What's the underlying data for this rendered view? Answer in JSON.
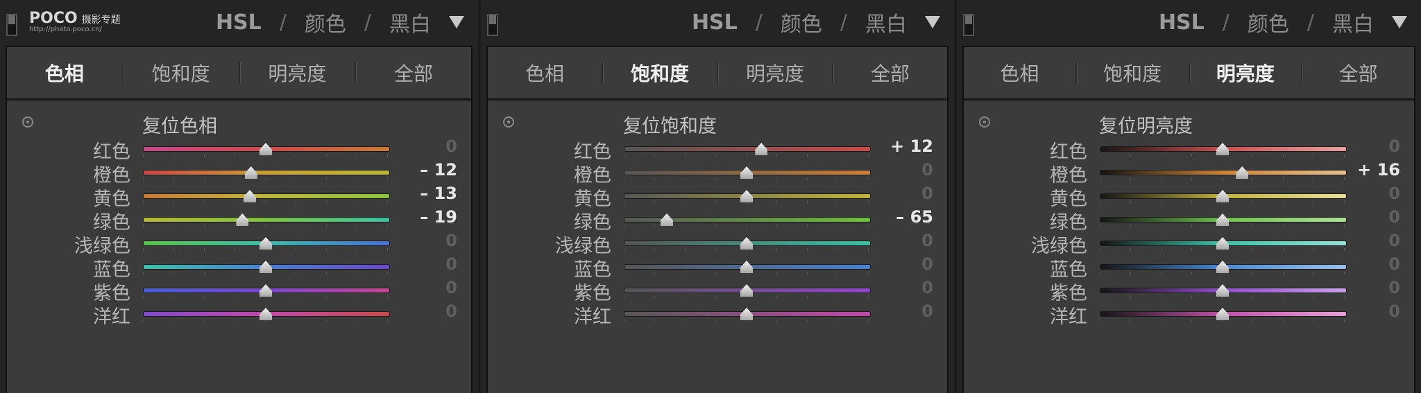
{
  "watermark": {
    "logo": "POCO",
    "title": "摄影专题",
    "url": "http://photo.poco.cn/"
  },
  "header": {
    "hsl": "HSL",
    "color": "颜色",
    "bw": "黑白"
  },
  "panels": [
    {
      "tabs": [
        "色相",
        "饱和度",
        "明亮度",
        "全部"
      ],
      "active_tab": 0,
      "reset_label": "复位色相",
      "rows": [
        {
          "label": "红色",
          "value": "0",
          "num": 0,
          "track": "linear-gradient(to right,#c44a8a,#c94a4a,#c97a3a)"
        },
        {
          "label": "橙色",
          "value": "– 12",
          "num": -12,
          "track": "linear-gradient(to right,#c84848,#c9a03a,#b7b63a)"
        },
        {
          "label": "黄色",
          "value": "– 13",
          "num": -13,
          "track": "linear-gradient(to right,#c97a3a,#bcb63a,#8cc040)"
        },
        {
          "label": "绿色",
          "value": "– 19",
          "num": -19,
          "track": "linear-gradient(to right,#b5b53a,#7ec043,#3ec0a2)"
        },
        {
          "label": "浅绿色",
          "value": "0",
          "num": 0,
          "track": "linear-gradient(to right,#5bc04a,#42b9a8,#4a6fd0)"
        },
        {
          "label": "蓝色",
          "value": "0",
          "num": 0,
          "track": "linear-gradient(to right,#3fc0a8,#4a7fd0,#6a48c8)"
        },
        {
          "label": "紫色",
          "value": "0",
          "num": 0,
          "track": "linear-gradient(to right,#4a60d0,#7c48c8,#c0488e)"
        },
        {
          "label": "洋红",
          "value": "0",
          "num": 0,
          "track": "linear-gradient(to right,#8048c8,#c048a8,#c44a4a)"
        }
      ]
    },
    {
      "tabs": [
        "色相",
        "饱和度",
        "明亮度",
        "全部"
      ],
      "active_tab": 1,
      "reset_label": "复位饱和度",
      "rows": [
        {
          "label": "红色",
          "value": "+ 12",
          "num": 12,
          "track": "linear-gradient(to right,#555,#c84a4a)"
        },
        {
          "label": "橙色",
          "value": "0",
          "num": 0,
          "track": "linear-gradient(to right,#555,#c9803a)"
        },
        {
          "label": "黄色",
          "value": "0",
          "num": 0,
          "track": "linear-gradient(to right,#555,#c0b43a)"
        },
        {
          "label": "绿色",
          "value": "– 65",
          "num": -65,
          "track": "linear-gradient(to right,#555,#70c040)"
        },
        {
          "label": "浅绿色",
          "value": "0",
          "num": 0,
          "track": "linear-gradient(to right,#555,#3ec0a2)"
        },
        {
          "label": "蓝色",
          "value": "0",
          "num": 0,
          "track": "linear-gradient(to right,#555,#4a80d0)"
        },
        {
          "label": "紫色",
          "value": "0",
          "num": 0,
          "track": "linear-gradient(to right,#555,#9048c8)"
        },
        {
          "label": "洋红",
          "value": "0",
          "num": 0,
          "track": "linear-gradient(to right,#555,#c048a8)"
        }
      ]
    },
    {
      "tabs": [
        "色相",
        "饱和度",
        "明亮度",
        "全部"
      ],
      "active_tab": 2,
      "reset_label": "复位明亮度",
      "rows": [
        {
          "label": "红色",
          "value": "0",
          "num": 0,
          "track": "linear-gradient(to right,#151515,#c85050,#e6a0a0)"
        },
        {
          "label": "橙色",
          "value": "+ 16",
          "num": 16,
          "track": "linear-gradient(to right,#151515,#c9843a,#e6c090)"
        },
        {
          "label": "黄色",
          "value": "0",
          "num": 0,
          "track": "linear-gradient(to right,#151515,#c0b040,#e6df9a)"
        },
        {
          "label": "绿色",
          "value": "0",
          "num": 0,
          "track": "linear-gradient(to right,#151515,#70c050,#b0e09a)"
        },
        {
          "label": "浅绿色",
          "value": "0",
          "num": 0,
          "track": "linear-gradient(to right,#151515,#40c0a8,#98e0d4)"
        },
        {
          "label": "蓝色",
          "value": "0",
          "num": 0,
          "track": "linear-gradient(to right,#151515,#4a88d0,#9cc0e8)"
        },
        {
          "label": "紫色",
          "value": "0",
          "num": 0,
          "track": "linear-gradient(to right,#151515,#9050c8,#c8a0e6)"
        },
        {
          "label": "洋红",
          "value": "0",
          "num": 0,
          "track": "linear-gradient(to right,#151515,#c050a8,#e6a0d4)"
        }
      ]
    }
  ]
}
